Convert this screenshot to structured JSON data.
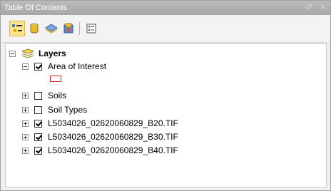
{
  "window": {
    "title": "Table Of Contents",
    "pin": "♂",
    "close": "×"
  },
  "toolbar": {
    "buttons": [
      {
        "icon": "list-by-drawing-order-icon",
        "active": true
      },
      {
        "icon": "list-by-source-icon",
        "active": false
      },
      {
        "icon": "list-by-visibility-icon",
        "active": false
      },
      {
        "icon": "list-by-selection-icon",
        "active": false
      },
      {
        "icon": "options-icon",
        "active": false
      }
    ]
  },
  "toc": {
    "root_label": "Layers",
    "layers": [
      {
        "label": "Area of Interest",
        "checked": true,
        "expanded": true,
        "symbol_color": "#e02020"
      },
      {
        "label": "Soils",
        "checked": false,
        "expanded": false
      },
      {
        "label": "Soil Types",
        "checked": false,
        "expanded": false
      },
      {
        "label": "L5034026_02620060829_B20.TIF",
        "checked": true,
        "expanded": false
      },
      {
        "label": "L5034026_02620060829_B30.TIF",
        "checked": true,
        "expanded": false
      },
      {
        "label": "L5034026_02620060829_B40.TIF",
        "checked": true,
        "expanded": false
      }
    ]
  }
}
